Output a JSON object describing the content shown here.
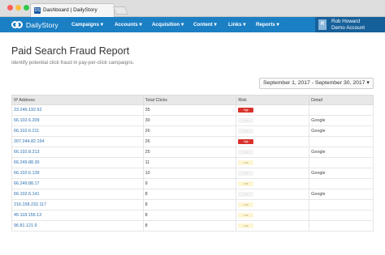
{
  "browser": {
    "tab_title": "Dashboard | DailyStory",
    "favicon": "DS"
  },
  "nav": {
    "brand": "DailyStory",
    "menu": [
      "Campaigns ▾",
      "Accounts ▾",
      "Acquisition ▾",
      "Content ▾",
      "Links ▾",
      "Reports ▾"
    ],
    "user": {
      "initial": "R",
      "name": "Rob Howard",
      "account": "Demo Account"
    }
  },
  "page": {
    "title": "Paid Search Fraud Report",
    "subtitle": "Identify potential click fraud in pay-per-click campaigns.",
    "date_range": "September 1, 2017 - September 30, 2017 ▾"
  },
  "table": {
    "headers": [
      "IP Address",
      "Total Clicks",
      "Risk",
      "Detail"
    ],
    "rows": [
      {
        "ip": "23.246.192.52",
        "clicks": "35",
        "risk": "High",
        "risk_level": "high",
        "detail": ""
      },
      {
        "ip": "66.102.6.209",
        "clicks": "30",
        "risk": "Low",
        "risk_level": "none",
        "detail": "Google"
      },
      {
        "ip": "66.102.6.211",
        "clicks": "26",
        "risk": "Low",
        "risk_level": "none",
        "detail": "Google"
      },
      {
        "ip": "207.244.82.154",
        "clicks": "26",
        "risk": "High",
        "risk_level": "high",
        "detail": ""
      },
      {
        "ip": "66.102.8.213",
        "clicks": "25",
        "risk": "Low",
        "risk_level": "none",
        "detail": "Google"
      },
      {
        "ip": "66.249.88.30",
        "clicks": "11",
        "risk": "Low",
        "risk_level": "low",
        "detail": ""
      },
      {
        "ip": "66.102.6.139",
        "clicks": "10",
        "risk": "Low",
        "risk_level": "none",
        "detail": "Google"
      },
      {
        "ip": "66.249.88.17",
        "clicks": "9",
        "risk": "Low",
        "risk_level": "low",
        "detail": ""
      },
      {
        "ip": "66.102.6.141",
        "clicks": "8",
        "risk": "Low",
        "risk_level": "none",
        "detail": "Google"
      },
      {
        "ip": "216.158.232.117",
        "clicks": "8",
        "risk": "Low",
        "risk_level": "low",
        "detail": ""
      },
      {
        "ip": "45.118.156.13",
        "clicks": "8",
        "risk": "Low",
        "risk_level": "low",
        "detail": ""
      },
      {
        "ip": "96.81.121.9",
        "clicks": "8",
        "risk": "Low",
        "risk_level": "low",
        "detail": ""
      }
    ]
  },
  "colors": {
    "nav": "#1b7fc4",
    "user_panel": "#16609a",
    "risk_high": "#d9312b",
    "risk_low": "#fdf6d5",
    "link": "#2a6fb0"
  }
}
